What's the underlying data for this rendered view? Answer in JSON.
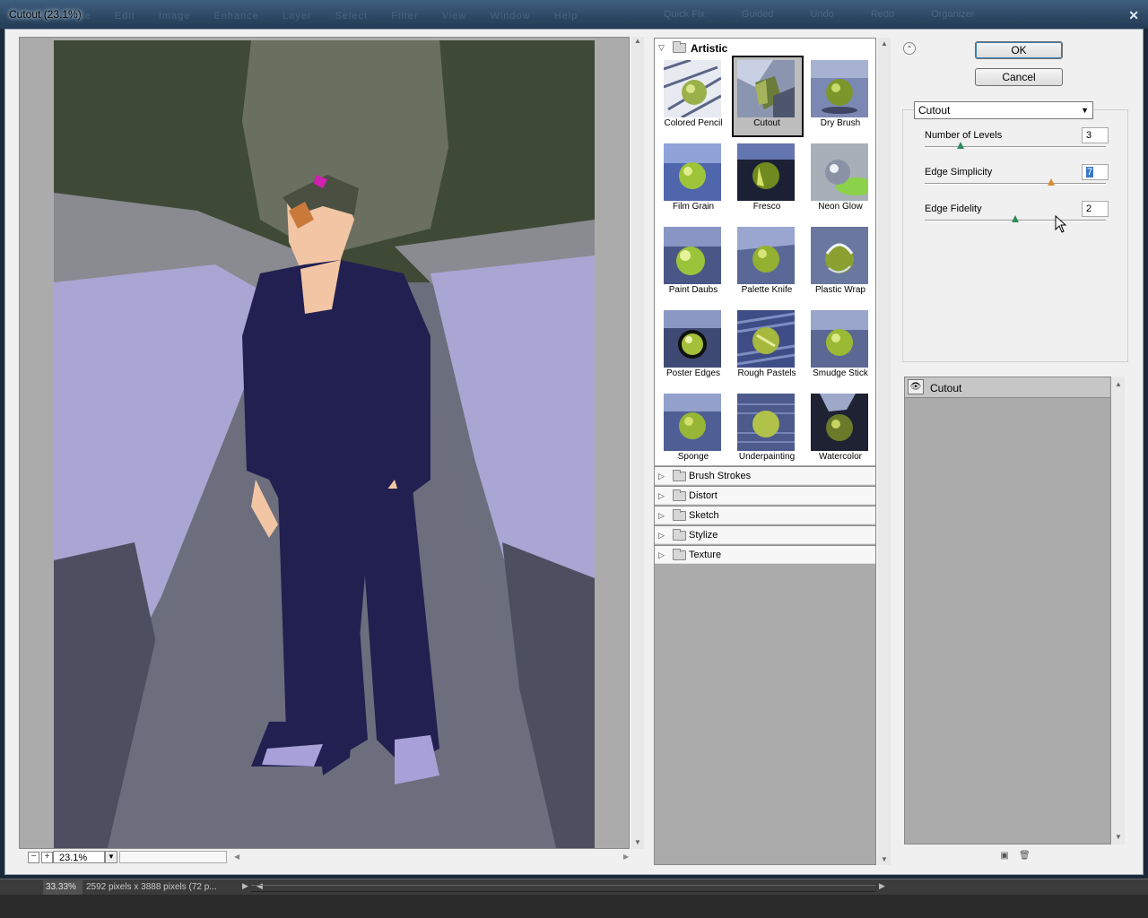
{
  "window": {
    "title": "Cutout (23.1%)",
    "close_glyph": "✕",
    "ghost_menu": [
      "File",
      "Edit",
      "Image",
      "Enhance",
      "Layer",
      "Select",
      "Filter",
      "View",
      "Window",
      "Help"
    ],
    "ghost_tools": [
      "Quick Fix",
      "Guided",
      "Undo",
      "Redo",
      "Organizer"
    ]
  },
  "preview": {
    "zoom_value": "23.1%",
    "zoom_out_label": "−",
    "zoom_in_label": "+"
  },
  "gallery": {
    "open_category": "Artistic",
    "filters": [
      {
        "name": "Colored Pencil",
        "selected": false
      },
      {
        "name": "Cutout",
        "selected": true
      },
      {
        "name": "Dry Brush",
        "selected": false
      },
      {
        "name": "Film Grain",
        "selected": false
      },
      {
        "name": "Fresco",
        "selected": false
      },
      {
        "name": "Neon Glow",
        "selected": false
      },
      {
        "name": "Paint Daubs",
        "selected": false
      },
      {
        "name": "Palette Knife",
        "selected": false
      },
      {
        "name": "Plastic Wrap",
        "selected": false
      },
      {
        "name": "Poster Edges",
        "selected": false
      },
      {
        "name": "Rough Pastels",
        "selected": false
      },
      {
        "name": "Smudge Stick",
        "selected": false
      },
      {
        "name": "Sponge",
        "selected": false
      },
      {
        "name": "Underpainting",
        "selected": false
      },
      {
        "name": "Watercolor",
        "selected": false
      }
    ],
    "closed_categories": [
      "Brush Strokes",
      "Distort",
      "Sketch",
      "Stylize",
      "Texture"
    ]
  },
  "buttons": {
    "ok": "OK",
    "cancel": "Cancel"
  },
  "settings": {
    "filter_select": "Cutout",
    "params": [
      {
        "label": "Number of Levels",
        "value": "3",
        "level": 0.2
      },
      {
        "label": "Edge Simplicity",
        "value": "7",
        "level": 0.7
      },
      {
        "label": "Edge Fidelity",
        "value": "2",
        "level": 0.5
      }
    ]
  },
  "layers": {
    "items": [
      {
        "name": "Cutout",
        "visible": true
      }
    ]
  },
  "status": {
    "zoom": "33.33%",
    "info": "2592 pixels x 3888 pixels (72 p..."
  },
  "colors": {
    "selection_highlight": "#3a78c9",
    "slider_knob": "#2f8a5b",
    "active_knob": "#d98a2d"
  }
}
